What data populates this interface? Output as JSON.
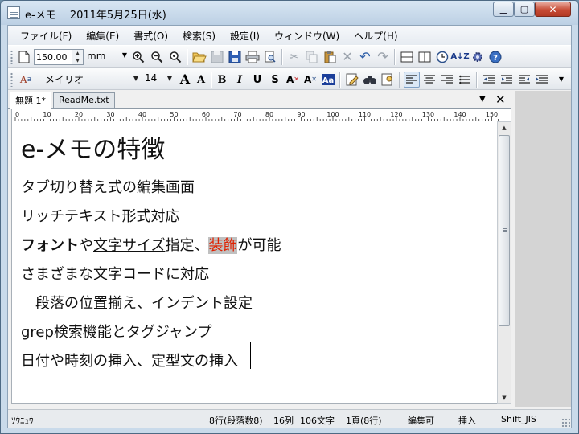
{
  "window": {
    "title": "e-メモ　 2011年5月25日(水)",
    "controls": {
      "minimize": "▁",
      "maximize": "▢",
      "close": "✕"
    }
  },
  "menu": [
    "ファイル(F)",
    "編集(E)",
    "書式(O)",
    "検索(S)",
    "設定(I)",
    "ウィンドウ(W)",
    "ヘルプ(H)"
  ],
  "toolbar": {
    "zoom_value": "150.00",
    "unit": "mm",
    "font_name": "メイリオ",
    "font_size": "14",
    "icons": {
      "new": "new-document-icon",
      "zoom_in": "zoom-in-icon",
      "zoom_out": "zoom-out-icon",
      "open": "folder-open-icon",
      "save": "save-icon",
      "print": "print-icon",
      "cut": "cut-icon",
      "paste": "paste-icon",
      "undo": "undo-icon",
      "redo": "redo-icon",
      "bold": "B",
      "italic": "I",
      "underline": "U",
      "strike": "S"
    }
  },
  "tabs": [
    {
      "label": "無題 1*",
      "active": true
    },
    {
      "label": "ReadMe.txt",
      "active": false
    }
  ],
  "document": {
    "heading": "e-メモの特徴",
    "lines": [
      "タブ切り替え式の編集画面",
      "リッチテキスト形式対応",
      "さまざまな文字コードに対応",
      "　段落の位置揃え、インデント設定",
      "grep検索機能とタグジャンプ",
      "日付や時刻の挿入、定型文の挿入"
    ],
    "rich_line": {
      "bold": "フォント",
      "p1": "や",
      "underlined": "文字サイズ",
      "p2": "指定、",
      "highlighted": "装飾",
      "p3": "が可能"
    }
  },
  "ruler": {
    "labels": [
      "0",
      "10",
      "20",
      "30",
      "40",
      "50",
      "60",
      "70",
      "80",
      "90",
      "100",
      "110",
      "120",
      "130",
      "140",
      "150"
    ]
  },
  "status": {
    "left": "ｿｳﾆｭｳ",
    "position": "8行(段落数8)",
    "column": "16列",
    "chars": "106文字",
    "page": "1頁(8行)",
    "edit_mode": "編集可",
    "insert_mode": "挿入",
    "encoding": "Shift_JIS"
  },
  "colors": {
    "highlight_background": "#c0c0c0",
    "highlight_text": "#e02000",
    "close_button": "#c74b35"
  }
}
